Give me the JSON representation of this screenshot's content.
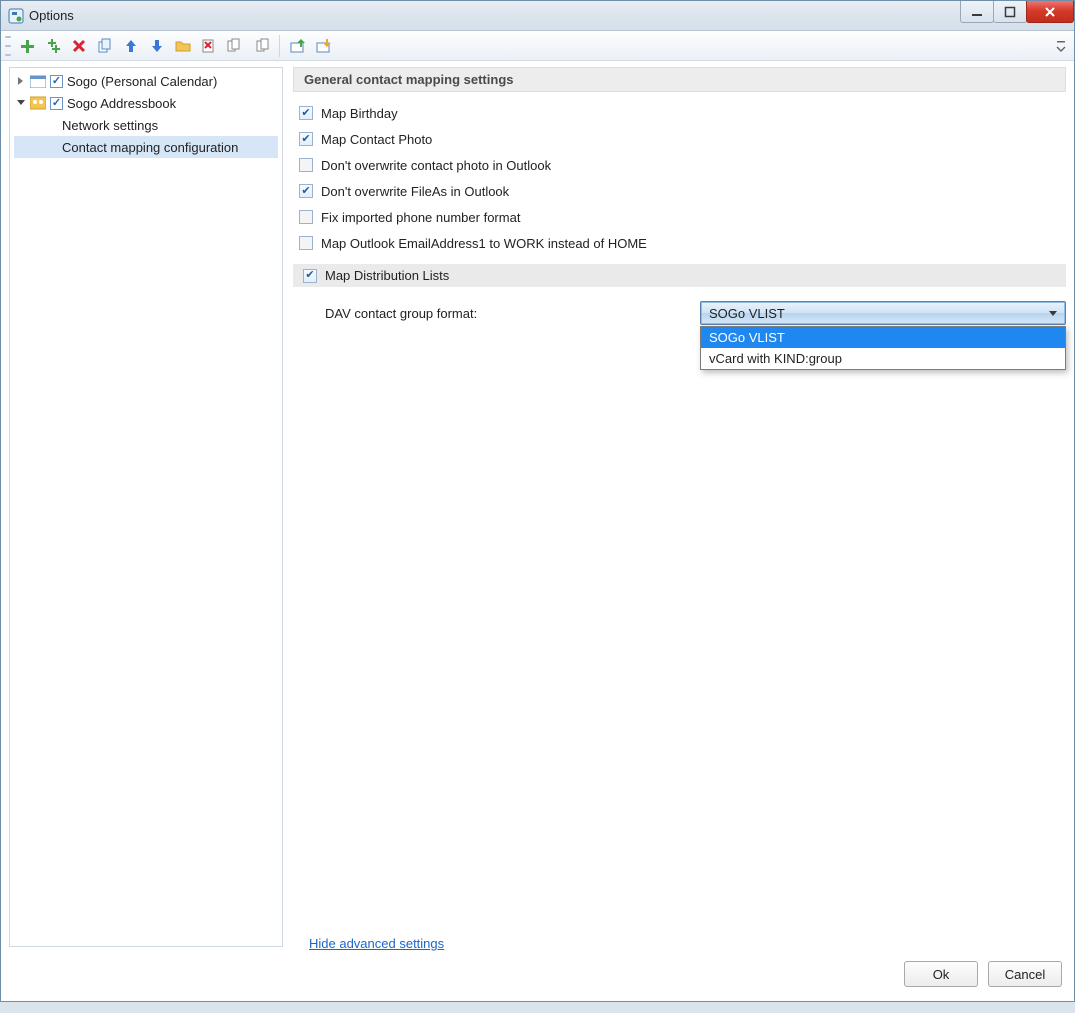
{
  "window": {
    "title": "Options"
  },
  "tree": {
    "items": [
      {
        "label": "Sogo (Personal Calendar)",
        "checked": true,
        "icon": "calendar"
      },
      {
        "label": "Sogo Addressbook",
        "checked": true,
        "icon": "contacts"
      }
    ],
    "children": [
      {
        "label": "Network settings"
      },
      {
        "label": "Contact mapping configuration"
      }
    ]
  },
  "panel": {
    "section_title": "General contact mapping settings",
    "checks": [
      {
        "label": "Map Birthday",
        "checked": true
      },
      {
        "label": "Map Contact Photo",
        "checked": true
      },
      {
        "label": "Don't overwrite contact photo in Outlook",
        "checked": false
      },
      {
        "label": "Don't overwrite FileAs in Outlook",
        "checked": true
      },
      {
        "label": "Fix imported phone number format",
        "checked": false
      },
      {
        "label": "Map Outlook EmailAddress1 to WORK instead of HOME",
        "checked": false
      }
    ],
    "dist_list": {
      "label": "Map Distribution Lists",
      "checked": true
    },
    "format_label": "DAV contact group format:",
    "format_value": "SOGo VLIST",
    "format_options": [
      "SOGo VLIST",
      "vCard with KIND:group"
    ]
  },
  "links": {
    "hide_advanced": "Hide advanced settings"
  },
  "buttons": {
    "ok": "Ok",
    "cancel": "Cancel"
  },
  "toolbar_icons": [
    "add",
    "add-multi",
    "delete",
    "copy",
    "move-up",
    "move-down",
    "folder",
    "clear",
    "copy-all",
    "paste-all",
    "import",
    "export"
  ]
}
